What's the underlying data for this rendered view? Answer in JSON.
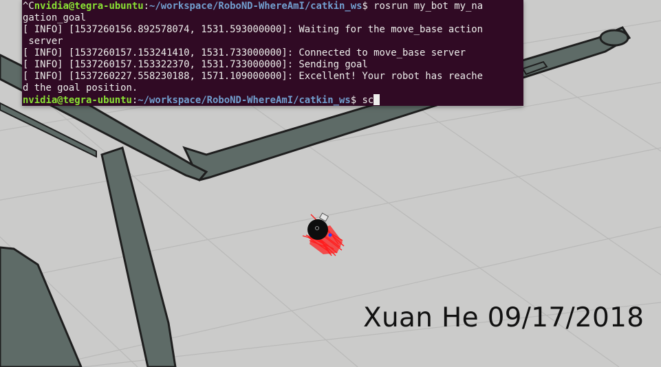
{
  "terminal": {
    "lines": [
      {
        "prefix": "^C",
        "user": "nvidia@tegra-ubuntu",
        "sep": ":",
        "path": "~/workspace/RoboND-WhereAmI/catkin_ws",
        "suffix": "$ rosrun my_bot my_na"
      },
      {
        "text": "gation_goal"
      },
      {
        "text": "[ INFO] [1537260156.892578074, 1531.593000000]: Waiting for the move_base action"
      },
      {
        "text": " server"
      },
      {
        "text": "[ INFO] [1537260157.153241410, 1531.733000000]: Connected to move_base server"
      },
      {
        "text": "[ INFO] [1537260157.153322370, 1531.733000000]: Sending goal"
      },
      {
        "text": "[ INFO] [1537260227.558230188, 1571.109000000]: Excellent! Your robot has reache"
      },
      {
        "text": "d the goal position."
      }
    ],
    "prompt": {
      "user": "nvidia@tegra-ubuntu",
      "sep": ":",
      "path": "~/workspace/RoboND-WhereAmI/catkin_ws",
      "suffix": "$ sc"
    }
  },
  "watermark": {
    "text": "Xuan He 09/17/2018"
  },
  "colors": {
    "terminal_bg": "#300a24",
    "terminal_fg": "#eeeeec",
    "prompt_user": "#8ae234",
    "prompt_path": "#729fcf",
    "floor": "#cbcbca",
    "grid": "#b8b8b7",
    "map_wall": "#5d6a66",
    "wall_edge": "#222222",
    "particles": "#ff1a1a",
    "robot": "#101010"
  }
}
